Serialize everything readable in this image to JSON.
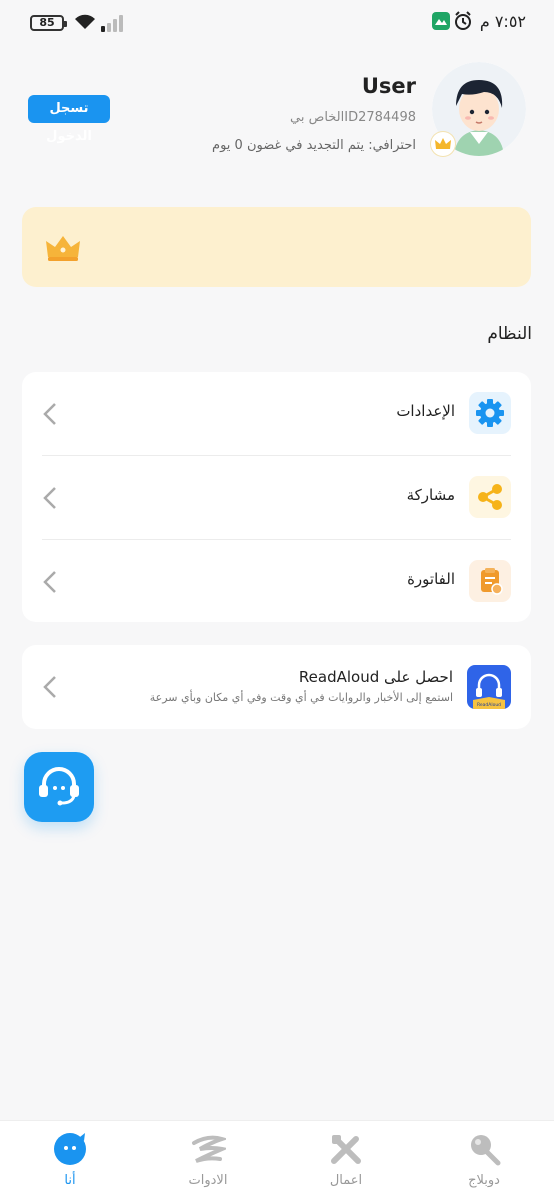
{
  "status_bar": {
    "battery": "85",
    "time": "٧:٥٢ م"
  },
  "profile": {
    "username": "User",
    "user_id": "ID2784498الخاص بي",
    "pro_status": "احترافي: يتم التجديد في غضون 0 يوم",
    "login_button": "تسجل الدخول"
  },
  "section_title": "النظام",
  "menu": {
    "items": [
      {
        "label": "الإعدادات",
        "icon": "gear-icon",
        "color": "#1a94f0",
        "bg": "#e6f3fd"
      },
      {
        "label": "مشاركة",
        "icon": "share-icon",
        "color": "#f6b319",
        "bg": "#fef6e1"
      },
      {
        "label": "الفاتورة",
        "icon": "invoice-icon",
        "color": "#f09a2c",
        "bg": "#fdf0e2"
      }
    ]
  },
  "readaloud": {
    "title": "احصل على ReadAloud",
    "subtitle": "استمع إلى الأخبار والروايات في أي وقت وفي أي مكان وبأي سرعة",
    "icon_caption": "ReadAloud"
  },
  "bottom_nav": {
    "items": [
      {
        "label": "دوبلاج",
        "icon": "dubbing-icon",
        "active": false
      },
      {
        "label": "اعمال",
        "icon": "works-icon",
        "active": false
      },
      {
        "label": "الادوات",
        "icon": "tools-icon",
        "active": false
      },
      {
        "label": "أنا",
        "icon": "me-icon",
        "active": true
      }
    ]
  },
  "colors": {
    "accent": "#1a94f0",
    "vip_banner": "#fdf0cf",
    "background": "#f7f7f8"
  }
}
